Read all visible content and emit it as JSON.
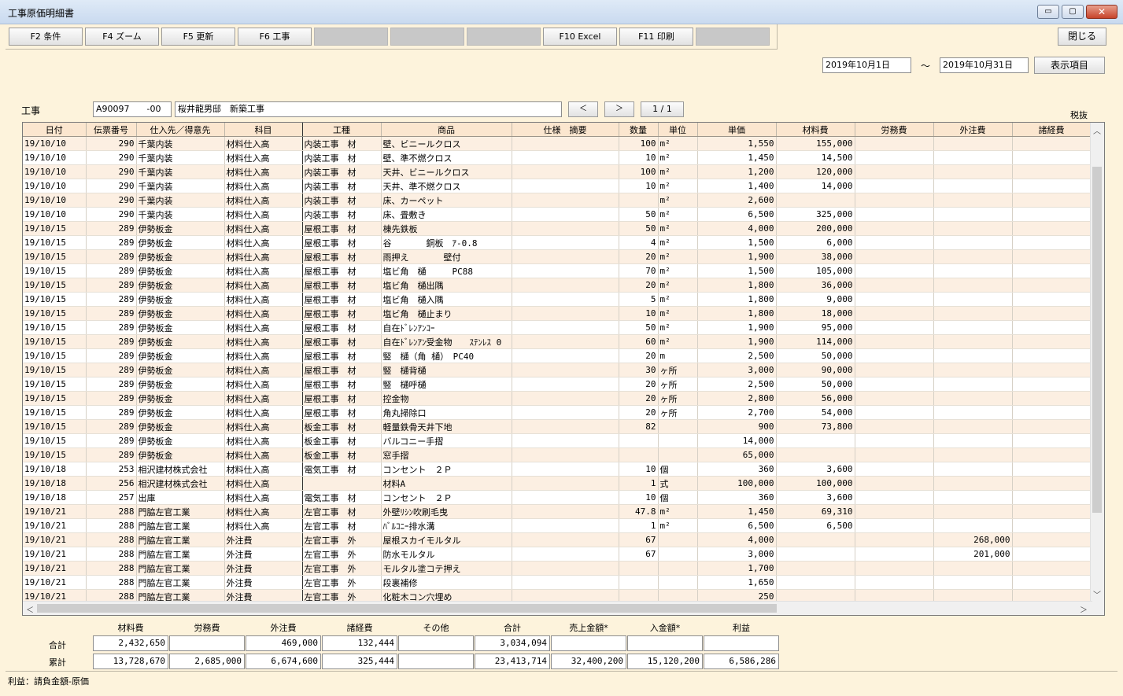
{
  "window": {
    "title": "工事原価明細書",
    "minimize": "▭",
    "maximize": "▢",
    "close": "✕"
  },
  "fkeys": [
    {
      "label": "F2 条件",
      "enabled": true
    },
    {
      "label": "F4 ズーム",
      "enabled": true
    },
    {
      "label": "F5 更新",
      "enabled": true
    },
    {
      "label": "F6 工事",
      "enabled": true
    },
    {
      "label": "",
      "enabled": false
    },
    {
      "label": "",
      "enabled": false
    },
    {
      "label": "",
      "enabled": false
    },
    {
      "label": "F10 Excel",
      "enabled": true
    },
    {
      "label": "F11 印刷",
      "enabled": true
    },
    {
      "label": "",
      "enabled": false
    }
  ],
  "close_button": "閉じる",
  "date_from": "2019年10月1日",
  "date_sep": "～",
  "date_to": "2019年10月31日",
  "display_items_button": "表示項目",
  "project": {
    "label": "工事",
    "code": "A90097　　-00",
    "name": "桜井龍男邸　新築工事",
    "prev": "＜",
    "next": "＞",
    "page": "1 / 1"
  },
  "tax_note": "税抜",
  "columns": [
    "日付",
    "伝票番号",
    "仕入先／得意先",
    "科目",
    "工種",
    "商品",
    "仕様　摘要",
    "数量",
    "単位",
    "単価",
    "材料費",
    "労務費",
    "外注費",
    "諸経費"
  ],
  "rows": [
    [
      "19/10/10",
      "290",
      "千葉内装",
      "材料仕入高",
      "内装工事　材",
      "壁、ビニールクロス",
      "",
      "100",
      "m²",
      "1,550",
      "155,000",
      "",
      "",
      ""
    ],
    [
      "19/10/10",
      "290",
      "千葉内装",
      "材料仕入高",
      "内装工事　材",
      "壁、準不燃クロス",
      "",
      "10",
      "m²",
      "1,450",
      "14,500",
      "",
      "",
      ""
    ],
    [
      "19/10/10",
      "290",
      "千葉内装",
      "材料仕入高",
      "内装工事　材",
      "天井、ビニールクロス",
      "",
      "100",
      "m²",
      "1,200",
      "120,000",
      "",
      "",
      ""
    ],
    [
      "19/10/10",
      "290",
      "千葉内装",
      "材料仕入高",
      "内装工事　材",
      "天井、準不燃クロス",
      "",
      "10",
      "m²",
      "1,400",
      "14,000",
      "",
      "",
      ""
    ],
    [
      "19/10/10",
      "290",
      "千葉内装",
      "材料仕入高",
      "内装工事　材",
      "床、カーペット",
      "",
      "",
      "m²",
      "2,600",
      "",
      "",
      "",
      ""
    ],
    [
      "19/10/10",
      "290",
      "千葉内装",
      "材料仕入高",
      "内装工事　材",
      "床、畳敷き",
      "",
      "50",
      "m²",
      "6,500",
      "325,000",
      "",
      "",
      ""
    ],
    [
      "19/10/15",
      "289",
      "伊勢板金",
      "材料仕入高",
      "屋根工事　材",
      "棟先鉄板",
      "",
      "50",
      "m²",
      "4,000",
      "200,000",
      "",
      "",
      ""
    ],
    [
      "19/10/15",
      "289",
      "伊勢板金",
      "材料仕入高",
      "屋根工事　材",
      "谷　　　　銅板　ｱ-0.8",
      "",
      "4",
      "m²",
      "1,500",
      "6,000",
      "",
      "",
      ""
    ],
    [
      "19/10/15",
      "289",
      "伊勢板金",
      "材料仕入高",
      "屋根工事　材",
      "雨押え　　　　壁付",
      "",
      "20",
      "m²",
      "1,900",
      "38,000",
      "",
      "",
      ""
    ],
    [
      "19/10/15",
      "289",
      "伊勢板金",
      "材料仕入高",
      "屋根工事　材",
      "塩ビ角　樋　　　PC88",
      "",
      "70",
      "m²",
      "1,500",
      "105,000",
      "",
      "",
      ""
    ],
    [
      "19/10/15",
      "289",
      "伊勢板金",
      "材料仕入高",
      "屋根工事　材",
      "塩ビ角　樋出隅",
      "",
      "20",
      "m²",
      "1,800",
      "36,000",
      "",
      "",
      ""
    ],
    [
      "19/10/15",
      "289",
      "伊勢板金",
      "材料仕入高",
      "屋根工事　材",
      "塩ビ角　樋入隅",
      "",
      "5",
      "m²",
      "1,800",
      "9,000",
      "",
      "",
      ""
    ],
    [
      "19/10/15",
      "289",
      "伊勢板金",
      "材料仕入高",
      "屋根工事　材",
      "塩ビ角　樋止まり",
      "",
      "10",
      "m²",
      "1,800",
      "18,000",
      "",
      "",
      ""
    ],
    [
      "19/10/15",
      "289",
      "伊勢板金",
      "材料仕入高",
      "屋根工事　材",
      "自在ﾄﾞﾚﾝｱﾝｺｰ",
      "",
      "50",
      "m²",
      "1,900",
      "95,000",
      "",
      "",
      ""
    ],
    [
      "19/10/15",
      "289",
      "伊勢板金",
      "材料仕入高",
      "屋根工事　材",
      "自在ﾄﾞﾚﾝｱﾝ受金物　　ｽﾃﾝﾚｽ 0",
      "",
      "60",
      "m²",
      "1,900",
      "114,000",
      "",
      "",
      ""
    ],
    [
      "19/10/15",
      "289",
      "伊勢板金",
      "材料仕入高",
      "屋根工事　材",
      "竪　樋（角 樋）　PC40",
      "",
      "20",
      "m",
      "2,500",
      "50,000",
      "",
      "",
      ""
    ],
    [
      "19/10/15",
      "289",
      "伊勢板金",
      "材料仕入高",
      "屋根工事　材",
      "竪　樋背樋",
      "",
      "30",
      "ヶ所",
      "3,000",
      "90,000",
      "",
      "",
      ""
    ],
    [
      "19/10/15",
      "289",
      "伊勢板金",
      "材料仕入高",
      "屋根工事　材",
      "竪　樋呼樋",
      "",
      "20",
      "ヶ所",
      "2,500",
      "50,000",
      "",
      "",
      ""
    ],
    [
      "19/10/15",
      "289",
      "伊勢板金",
      "材料仕入高",
      "屋根工事　材",
      "控金物",
      "",
      "20",
      "ヶ所",
      "2,800",
      "56,000",
      "",
      "",
      ""
    ],
    [
      "19/10/15",
      "289",
      "伊勢板金",
      "材料仕入高",
      "屋根工事　材",
      "角丸掃除口",
      "",
      "20",
      "ヶ所",
      "2,700",
      "54,000",
      "",
      "",
      ""
    ],
    [
      "19/10/15",
      "289",
      "伊勢板金",
      "材料仕入高",
      "板金工事　材",
      "軽量鉄骨天井下地",
      "",
      "82",
      "",
      "900",
      "73,800",
      "",
      "",
      ""
    ],
    [
      "19/10/15",
      "289",
      "伊勢板金",
      "材料仕入高",
      "板金工事　材",
      "バルコニー手摺",
      "",
      "",
      "",
      "14,000",
      "",
      "",
      "",
      ""
    ],
    [
      "19/10/15",
      "289",
      "伊勢板金",
      "材料仕入高",
      "板金工事　材",
      "窓手摺",
      "",
      "",
      "",
      "65,000",
      "",
      "",
      "",
      ""
    ],
    [
      "19/10/18",
      "253",
      "相沢建材株式会社",
      "材料仕入高",
      "電気工事　材",
      "コンセント　２Ｐ",
      "",
      "10",
      "個",
      "360",
      "3,600",
      "",
      "",
      ""
    ],
    [
      "19/10/18",
      "256",
      "相沢建材株式会社",
      "材料仕入高",
      "",
      "材料A",
      "",
      "1",
      "式",
      "100,000",
      "100,000",
      "",
      "",
      ""
    ],
    [
      "19/10/18",
      "257",
      "出庫",
      "材料仕入高",
      "電気工事　材",
      "コンセント　２Ｐ",
      "",
      "10",
      "個",
      "360",
      "3,600",
      "",
      "",
      ""
    ],
    [
      "19/10/21",
      "288",
      "門脇左官工業",
      "材料仕入高",
      "左官工事　材",
      "外壁ﾘｼﾝ吹刷毛曳",
      "",
      "47.8",
      "m²",
      "1,450",
      "69,310",
      "",
      "",
      ""
    ],
    [
      "19/10/21",
      "288",
      "門脇左官工業",
      "材料仕入高",
      "左官工事　材",
      "ﾊﾞﾙｺﾆｰ排水溝",
      "",
      "1",
      "m²",
      "6,500",
      "6,500",
      "",
      "",
      ""
    ],
    [
      "19/10/21",
      "288",
      "門脇左官工業",
      "外注費",
      "左官工事　外",
      "屋根スカイモルタル",
      "",
      "67",
      "",
      "4,000",
      "",
      "",
      "268,000",
      ""
    ],
    [
      "19/10/21",
      "288",
      "門脇左官工業",
      "外注費",
      "左官工事　外",
      "防水モルタル",
      "",
      "67",
      "",
      "3,000",
      "",
      "",
      "201,000",
      ""
    ],
    [
      "19/10/21",
      "288",
      "門脇左官工業",
      "外注費",
      "左官工事　外",
      "モルタル塗コテ押え",
      "",
      "",
      "",
      "1,700",
      "",
      "",
      "",
      ""
    ],
    [
      "19/10/21",
      "288",
      "門脇左官工業",
      "外注費",
      "左官工事　外",
      "段裏補修",
      "",
      "",
      "",
      "1,650",
      "",
      "",
      "",
      ""
    ],
    [
      "19/10/21",
      "288",
      "門脇左官工業",
      "外注費",
      "左官工事　外",
      "化粧木コン穴埋め",
      "",
      "",
      "",
      "250",
      "",
      "",
      "",
      ""
    ]
  ],
  "scroll": {
    "up": "︿",
    "down": "﹀",
    "left": "＜",
    "right": "＞"
  },
  "summary": {
    "headers": [
      "材料費",
      "労務費",
      "外注費",
      "諸経費",
      "その他",
      "合計",
      "売上金額*",
      "入金額*",
      "利益"
    ],
    "total_label": "合計",
    "total": [
      "2,432,650",
      "",
      "469,000",
      "132,444",
      "",
      "3,034,094",
      "",
      "",
      ""
    ],
    "cumulative_label": "累計",
    "cumulative": [
      "13,728,670",
      "2,685,000",
      "6,674,600",
      "325,444",
      "",
      "23,413,714",
      "32,400,200",
      "15,120,200",
      "6,586,286"
    ]
  },
  "status": "利益：請負金額-原価"
}
